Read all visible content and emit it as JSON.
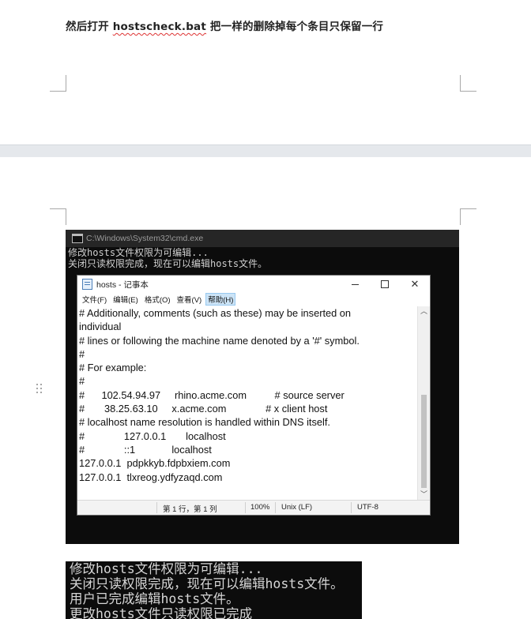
{
  "document": {
    "heading": {
      "prefix": "然后打开 ",
      "filename": "hostscheck.bat",
      "suffix": " 把一样的删除掉每个条目只保留一行"
    }
  },
  "cmd_window": {
    "title": "C:\\Windows\\System32\\cmd.exe",
    "lines": [
      "修改hosts文件权限为可编辑...",
      "关闭只读权限完成，现在可以编辑hosts文件。"
    ]
  },
  "notepad": {
    "title": "hosts - 记事本",
    "menu": [
      "文件(F)",
      "编辑(E)",
      "格式(O)",
      "查看(V)",
      "帮助(H)"
    ],
    "active_menu_index": 4,
    "lines": [
      "# Additionally, comments (such as these) may be inserted on",
      "individual",
      "# lines or following the machine name denoted by a '#' symbol.",
      "#",
      "# For example:",
      "#",
      "#      102.54.94.97     rhino.acme.com          # source server",
      "#       38.25.63.10     x.acme.com              # x client host",
      "# localhost name resolution is handled within DNS itself.",
      "#              127.0.0.1       localhost",
      "#              ::1             localhost",
      "127.0.0.1  pdpkkyb.fdpbxiem.com",
      "127.0.0.1  tlxreog.ydfyzaqd.com"
    ],
    "status": {
      "position": "第 1 行，第 1 列",
      "zoom": "100%",
      "line_ending": "Unix (LF)",
      "encoding": "UTF-8"
    }
  },
  "cmd_crop": {
    "lines": [
      "修改hosts文件权限为可编辑...",
      "关闭只读权限完成，现在可以编辑hosts文件。",
      "用户已完成编辑hosts文件。",
      "更改hosts文件只读权限已完成"
    ]
  }
}
